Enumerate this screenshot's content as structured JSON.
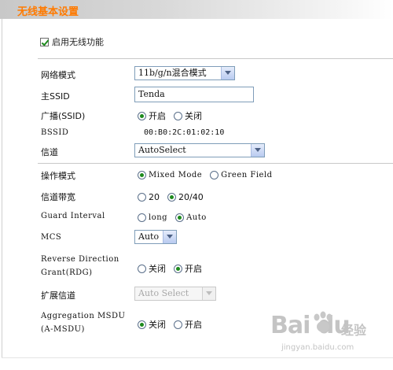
{
  "window": {
    "title": "无线基本设置"
  },
  "enable_wireless": {
    "label": "启用无线功能",
    "checked": true
  },
  "rows": {
    "network_mode": {
      "label": "网络模式",
      "value": "11b/g/n混合模式"
    },
    "primary_ssid": {
      "label": "主SSID",
      "value": "Tenda"
    },
    "broadcast": {
      "label": "广播(SSID)",
      "options": [
        "开启",
        "关闭"
      ],
      "selected": "开启"
    },
    "bssid": {
      "label": "BSSID",
      "value": "00:B0:2C:01:02:10"
    },
    "channel": {
      "label": "信道",
      "value": "AutoSelect"
    },
    "operating_mode": {
      "label": "操作模式",
      "options": [
        "Mixed Mode",
        "Green Field"
      ],
      "selected": "Mixed Mode"
    },
    "channel_bandwidth": {
      "label": "信道带宽",
      "options": [
        "20",
        "20/40"
      ],
      "selected": "20/40"
    },
    "guard_interval": {
      "label": "Guard Interval",
      "options": [
        "long",
        "Auto"
      ],
      "selected": "Auto"
    },
    "mcs": {
      "label": "MCS",
      "value": "Auto"
    },
    "rdg": {
      "label_line1": "Reverse Direction",
      "label_line2": "Grant(RDG)",
      "options": [
        "关闭",
        "开启"
      ],
      "selected": "开启"
    },
    "extension_channel": {
      "label": "扩展信道",
      "value": "Auto Select"
    },
    "amsdu": {
      "label_line1": "Aggregation MSDU",
      "label_line2": "(A-MSDU)",
      "options": [
        "关闭",
        "开启"
      ],
      "selected": "关闭"
    }
  },
  "watermark": {
    "brand": "Bai du",
    "suffix": "经验",
    "url": "jingyan.baidu.com"
  }
}
